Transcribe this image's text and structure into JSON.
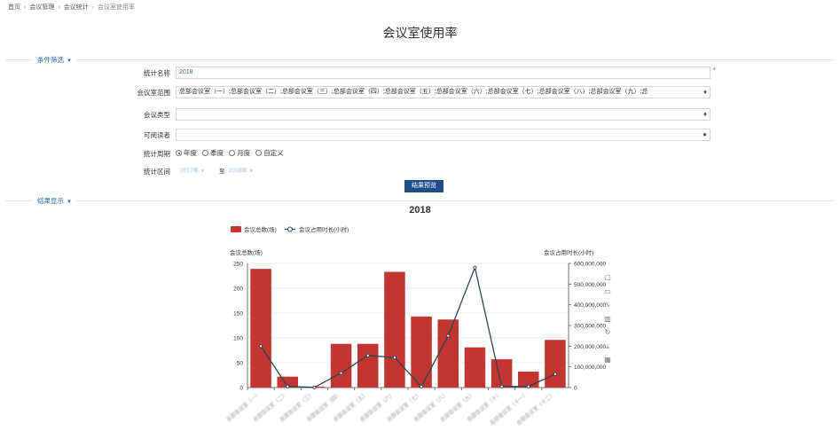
{
  "breadcrumb": {
    "items": [
      "首页",
      "会议管理",
      "会议统计",
      "会议室使用率"
    ]
  },
  "page_title": "会议室使用率",
  "filter": {
    "section_label": "条件筛选",
    "name_label": "统计名称",
    "name_value": "2018",
    "required_mark": "*",
    "rooms_label": "会议室范围",
    "rooms_value": "总部会议室（一）;总部会议室（二）;总部会议室（三）;总部会议室（四）;总部会议室（五）;总部会议室（六）;总部会议室（七）;总部会议室（八）;总部会议室（九）;总",
    "type_label": "会议类型",
    "type_value": "",
    "readers_label": "可阅读者",
    "readers_value": "",
    "period_label": "统计周期",
    "period_options": [
      "年度",
      "季度",
      "月度",
      "自定义"
    ],
    "period_selected": 0,
    "range_label": "统计区间",
    "range_start": "2017年",
    "range_end": "2018年",
    "range_sep": "至",
    "preview_button": "结果预览",
    "icons": {
      "type": "tag-icon",
      "readers": "user-icon",
      "rooms": "tag-icon"
    }
  },
  "result": {
    "section_label": "结果显示",
    "toolbox_icons": [
      "fullscreen-icon",
      "data-view-icon",
      "line-switch-icon",
      "bar-switch-icon",
      "restore-icon",
      "save-image-icon",
      "table-icon"
    ]
  },
  "colors": {
    "bar": "#c23531",
    "line": "#2f4554",
    "accent": "#2d6ca2",
    "button": "#1f4e8c"
  },
  "chart_data": {
    "type": "bar",
    "title": "2018",
    "categories": [
      "总部会议室（一）",
      "总部会议室（二）",
      "总部会议室（三）",
      "总部会议室（四）",
      "总部会议室（五）",
      "总部会议室（六）",
      "总部会议室（七）",
      "总部会议室（八）",
      "总部会议室（九）",
      "总部会议室（十）",
      "总部会议室（十一）",
      "总部会议室（十二）"
    ],
    "series": [
      {
        "name": "会议总数(场)",
        "type": "bar",
        "axis": "left",
        "values": [
          239,
          22,
          2,
          88,
          88,
          233,
          143,
          137,
          81,
          57,
          32,
          96
        ]
      },
      {
        "name": "会议占用时长(小时)",
        "type": "line",
        "axis": "right",
        "values": [
          200000000,
          5000000,
          1000000,
          70000000,
          155000000,
          145000000,
          5000000,
          250000000,
          580000000,
          5000000,
          5000000,
          65000000
        ]
      }
    ],
    "ylabel": "会议总数(场)",
    "ylabel_right": "会议占用时长(小时)",
    "ylim": [
      0,
      250
    ],
    "ylim_right": [
      0,
      600000000
    ],
    "yticks": [
      "0",
      "50",
      "100",
      "150",
      "200",
      "250"
    ],
    "yticks_right": [
      "0",
      "100,000,000",
      "200,000,000",
      "300,000,000",
      "400,000,000",
      "500,000,000",
      "600,000,000"
    ],
    "legend": "top-left",
    "grid": true
  }
}
